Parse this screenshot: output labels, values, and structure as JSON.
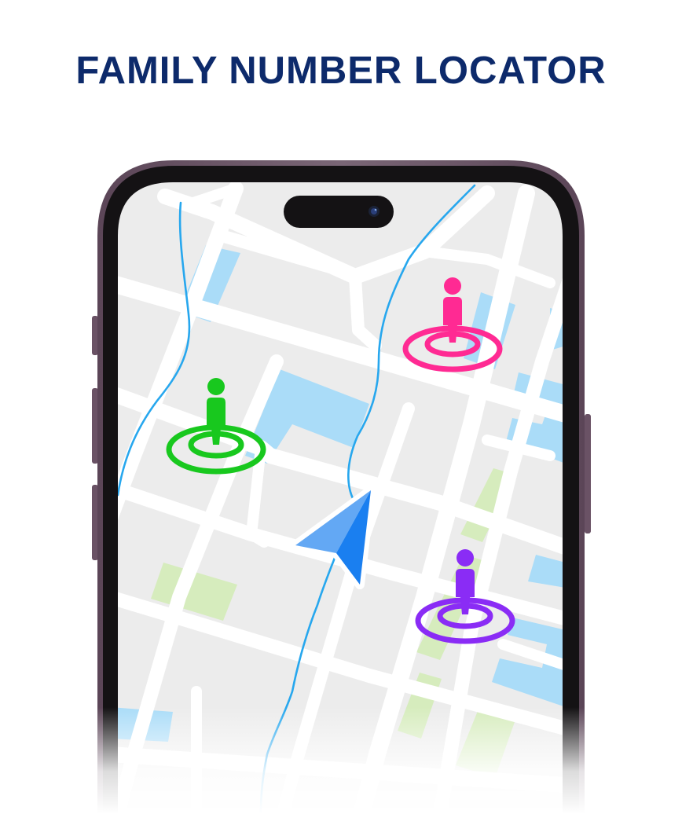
{
  "header": {
    "title": "FAMILY NUMBER LOCATOR"
  },
  "colors": {
    "title": "#0d2a6b",
    "phone_frame": "#6e5868",
    "map_background": "#ececec",
    "road": "#ffffff",
    "water_line": "#27a7ee",
    "building_blue": "#aadcf8",
    "park_green": "#d6ecbd",
    "pin_green": "#18c81e",
    "pin_pink": "#ff2a93",
    "pin_purple": "#8a2cf5",
    "navigation_arrow": "#1a7ff0"
  },
  "map": {
    "icons": {
      "camera": "camera-icon",
      "navigation": "navigation-arrow-icon",
      "pin": "person-pin-icon"
    },
    "members": [
      {
        "name_icon": "person-pin-green",
        "color": "#18c81e"
      },
      {
        "name_icon": "person-pin-pink",
        "color": "#ff2a93"
      },
      {
        "name_icon": "person-pin-purple",
        "color": "#8a2cf5"
      }
    ]
  }
}
